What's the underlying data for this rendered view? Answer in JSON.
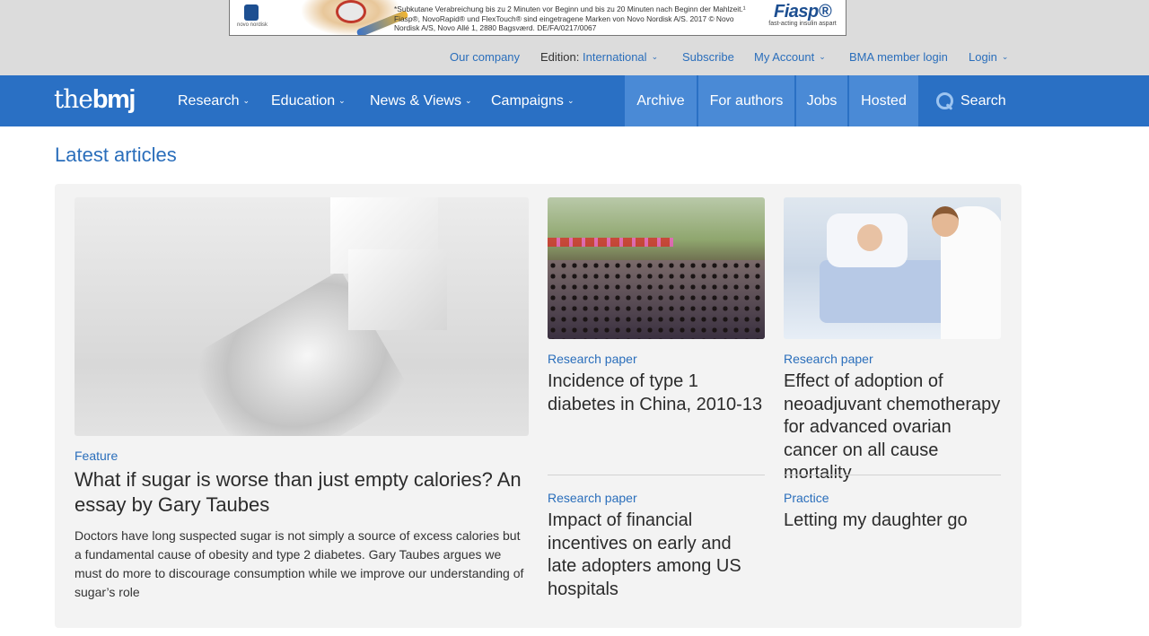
{
  "ad": {
    "company": "novo nordisk",
    "text": "*Subkutane Verabreichung bis zu 2 Minuten vor Beginn und bis zu 20 Minuten nach Beginn der Mahlzeit.¹ Fiasp®, NovoRapid® und FlexTouch® sind eingetragene Marken von Novo Nordisk A/S. 2017 © Novo Nordisk A/S, Novo Allé 1, 2880 Bagsværd. DE/FA/0217/0067",
    "brand": "Fiasp®",
    "tagline": "fast-acting insulin aspart"
  },
  "utility_nav": {
    "our_company": "Our company",
    "edition_label": "Edition:",
    "edition_value": "International",
    "subscribe": "Subscribe",
    "my_account": "My Account",
    "bma_login": "BMA member login",
    "login": "Login"
  },
  "main_nav": {
    "logo_prefix": "the",
    "logo_bold": "bmj",
    "items": [
      {
        "label": "Research"
      },
      {
        "label": "Education"
      },
      {
        "label": "News & Views"
      },
      {
        "label": "Campaigns"
      }
    ],
    "right_items": [
      {
        "label": "Archive"
      },
      {
        "label": "For authors"
      },
      {
        "label": "Jobs"
      },
      {
        "label": "Hosted"
      }
    ],
    "search_label": "Search"
  },
  "latest": {
    "title": "Latest articles",
    "lead": {
      "category": "Feature",
      "title": "What if sugar is worse than just empty calories? An essay by Gary Taubes",
      "summary": "Doctors have long suspected sugar is not simply a source of excess calories but a fundamental cause of obesity and type 2 diabetes. Gary Taubes argues we must do more to discourage consumption while we improve our understanding of sugar’s role"
    },
    "articles": [
      {
        "category": "Research paper",
        "title": "Incidence of type 1 diabetes in China, 2010-13"
      },
      {
        "category": "Research paper",
        "title": "Effect of adoption of neoadjuvant chemotherapy for advanced ovarian cancer on all cause mortality"
      },
      {
        "category": "Research paper",
        "title": "Impact of financial incentives on early and late adopters among US hospitals"
      },
      {
        "category": "Practice",
        "title": "Letting my daughter go"
      }
    ]
  }
}
